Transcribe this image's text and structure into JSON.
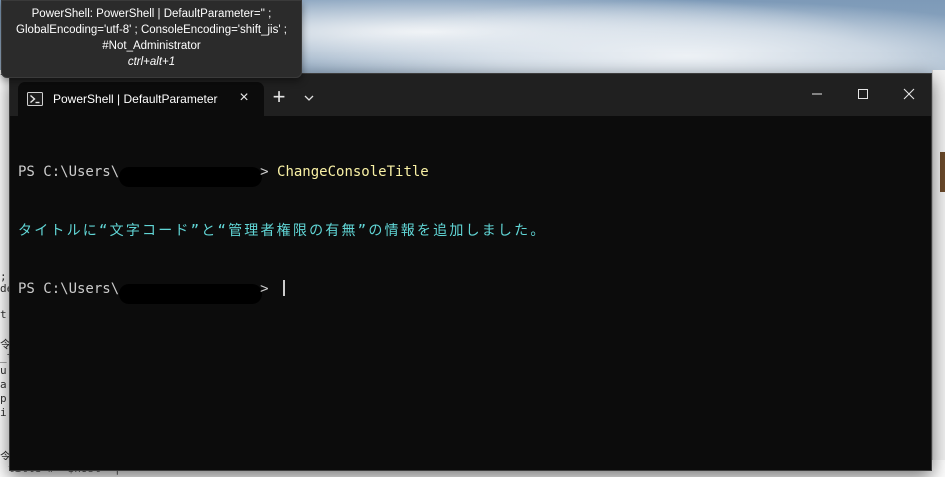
{
  "tooltip": {
    "line1": "PowerShell: PowerShell | DefaultParameter='' ;",
    "line2": "GlobalEncoding='utf-8' ; ConsoleEncoding='shift_jis' ;",
    "line3": "#Not_Administrator",
    "shortcut": "ctrl+alt+1"
  },
  "tab": {
    "title": "PowerShell | DefaultParameter",
    "icon": "powershell-icon",
    "close": "×"
  },
  "titlebar": {
    "new_tab": "+",
    "dropdown_icon": "chevron-down-icon",
    "minimize_icon": "minimize-icon",
    "maximize_icon": "maximize-icon",
    "close_icon": "close-icon"
  },
  "console": {
    "line1_prompt_start": "PS C:\\Users\\",
    "line1_prompt_end": "> ",
    "line1_command": "ChangeConsoleTitle",
    "line2_message": "タイトルに“文字コード”と“管理者権限の有無”の情報を追加しました。",
    "line3_prompt_start": "PS C:\\Users\\",
    "line3_prompt_end": "> "
  },
  "background": {
    "left_fragments": [
      "^",
      ";",
      "de",
      "t",
      "令",
      "_t",
      "u",
      "a",
      "p",
      "i",
      "令"
    ],
    "bottom_text": "title  #  `$host  `|\"`"
  },
  "colors": {
    "console_bg": "#0c0c0c",
    "titlebar_bg": "#202020",
    "command_yellow": "#f9f1a5",
    "message_cyan": "#61d6d6",
    "text_gray": "#cccccc"
  }
}
